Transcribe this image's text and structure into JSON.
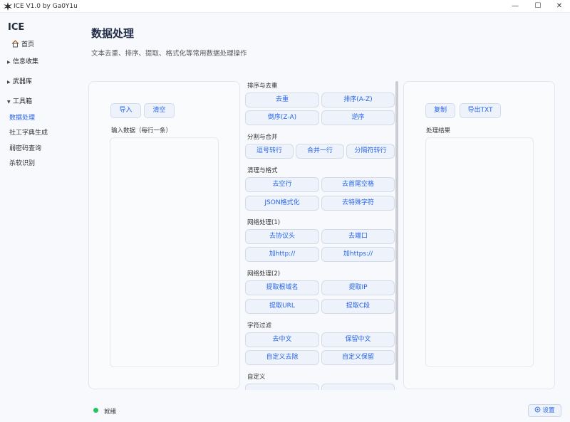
{
  "window": {
    "title": "ICE V1.0 by Ga0Y1u"
  },
  "sidebar": {
    "brand": "ICE",
    "home_label": "首页",
    "groups": [
      {
        "label": "信息收集",
        "expanded": false
      },
      {
        "label": "武器库",
        "expanded": false
      },
      {
        "label": "工具箱",
        "expanded": true
      }
    ],
    "tool_items": [
      "数据处理",
      "社工字典生成",
      "弱密码查询",
      "杀软识别"
    ],
    "active_item": "数据处理"
  },
  "page": {
    "title": "数据处理",
    "description": "文本去重、排序、提取、格式化等常用数据处理操作"
  },
  "input_panel": {
    "import_label": "导入",
    "clear_label": "清空",
    "field_label": "输入数据（每行一条）",
    "value": ""
  },
  "output_panel": {
    "copy_label": "复制",
    "export_label": "导出TXT",
    "field_label": "处理结果",
    "value": ""
  },
  "operations": [
    {
      "title": "排序与去重",
      "buttons": [
        "去重",
        "排序(A-Z)",
        "倒序(Z-A)",
        "逆序"
      ]
    },
    {
      "title": "分割与合并",
      "buttons": [
        "逗号转行",
        "合并一行",
        "分隔符转行"
      ]
    },
    {
      "title": "清理与格式",
      "buttons": [
        "去空行",
        "去首尾空格",
        "JSON格式化",
        "去特殊字符"
      ]
    },
    {
      "title": "网络处理(1)",
      "buttons": [
        "去协议头",
        "去端口",
        "加http://",
        "加https://"
      ]
    },
    {
      "title": "网络处理(2)",
      "buttons": [
        "提取根域名",
        "提取IP",
        "提取URL",
        "提取C段"
      ]
    },
    {
      "title": "字符过滤",
      "buttons": [
        "去中文",
        "保留中文",
        "自定义去除",
        "自定义保留"
      ]
    },
    {
      "title": "自定义",
      "buttons": [
        "",
        ""
      ]
    }
  ],
  "status": {
    "text": "就绪",
    "color": "#22c55e"
  },
  "settings_label": "设置",
  "colors": {
    "accent": "#2563eb",
    "title": "#1f2a44"
  }
}
